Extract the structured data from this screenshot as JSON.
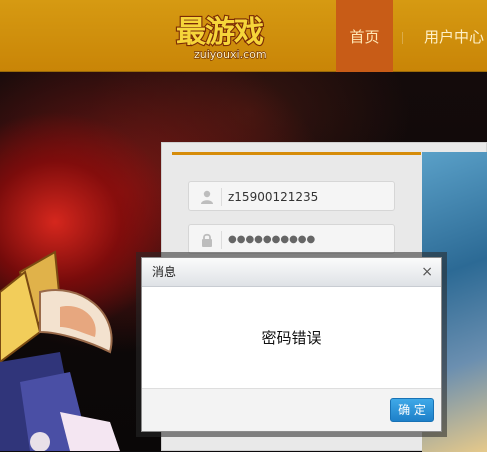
{
  "header": {
    "logo_text": "最游戏",
    "logo_sub": "zuiyouxi.com",
    "nav": [
      {
        "label": "首页",
        "active": true
      },
      {
        "label": "用户中心"
      }
    ]
  },
  "login_form": {
    "username_value": "z15900121235",
    "password_masked": "●●●●●●●●●●",
    "user_icon": "user-icon",
    "lock_icon": "lock-icon"
  },
  "dialog": {
    "title": "消息",
    "close_glyph": "×",
    "message": "密码错误",
    "ok_label": "确 定"
  },
  "colors": {
    "header_bg": "#d08d0c",
    "nav_active": "#c85c17",
    "accent": "#d68c0a",
    "button_blue": "#2b93d8"
  }
}
